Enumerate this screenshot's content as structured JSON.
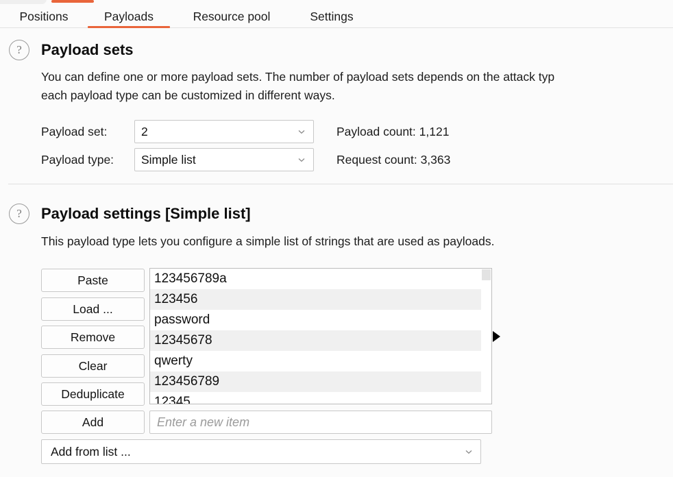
{
  "window": {
    "background_color": "#fbfbfb",
    "accent_color": "#e9653b"
  },
  "top_strip": {
    "partial_tab_present": true,
    "accent_bar_color": "#e9653b"
  },
  "tabbar": {
    "tabs": [
      {
        "label": "Positions",
        "active": false
      },
      {
        "label": "Payloads",
        "active": true
      },
      {
        "label": "Resource pool",
        "active": false
      },
      {
        "label": "Settings",
        "active": false
      }
    ]
  },
  "payload_sets": {
    "help_icon": "question-mark-icon",
    "title": "Payload sets",
    "description_line1": "You can define one or more payload sets. The number of payload sets depends on the attack typ",
    "description_line2": "each payload type can be customized in different ways.",
    "payload_set_label": "Payload set:",
    "payload_set_value": "2",
    "payload_type_label": "Payload type:",
    "payload_type_value": "Simple list",
    "payload_count": "Payload count: 1,121",
    "request_count": "Request count: 3,363",
    "chevron_icon": "chevron-down-icon"
  },
  "payload_settings": {
    "help_icon": "question-mark-icon",
    "title": "Payload settings [Simple list]",
    "description": "This payload type lets you configure a simple list of strings that are used as payloads.",
    "buttons": [
      {
        "label": "Paste"
      },
      {
        "label": "Load ..."
      },
      {
        "label": "Remove"
      },
      {
        "label": "Clear"
      },
      {
        "label": "Deduplicate"
      },
      {
        "label": "Add"
      }
    ],
    "list_items": [
      "123456789a",
      "123456",
      "password",
      "12345678",
      "qwerty",
      "123456789",
      "12345"
    ],
    "new_item_value": "",
    "new_item_placeholder": "Enter a new item",
    "add_from_list_value": "Add from list ...",
    "add_from_list_chevron": "chevron-down-icon",
    "marker_icon": "triangle-right-icon",
    "scrollbar": "vertical-scrollbar"
  }
}
